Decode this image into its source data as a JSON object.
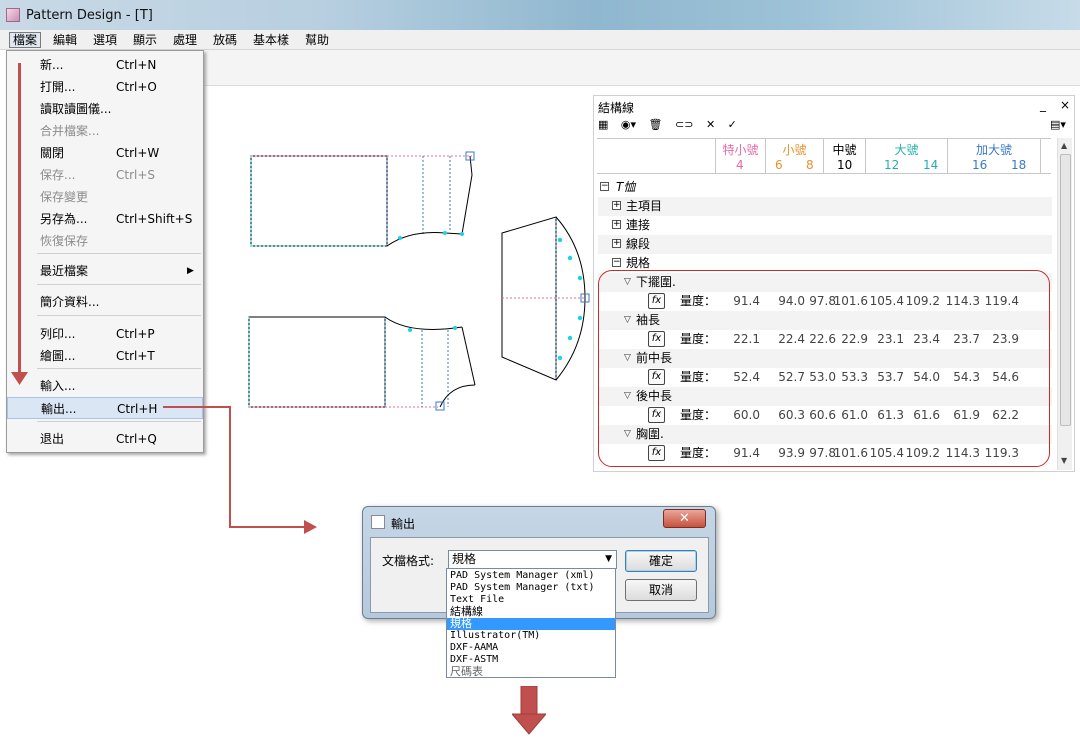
{
  "window": {
    "title": "Pattern Design - [T]"
  },
  "menubar": [
    "檔案",
    "編輯",
    "選項",
    "顯示",
    "處理",
    "放碼",
    "基本樣",
    "幫助"
  ],
  "file_menu": {
    "items": [
      {
        "label": "新...",
        "shortcut": "Ctrl+N",
        "disabled": false
      },
      {
        "label": "打開...",
        "shortcut": "Ctrl+O",
        "disabled": false
      },
      {
        "label": "讀取讀圖儀...",
        "shortcut": "",
        "disabled": false
      },
      {
        "label": "合并檔案...",
        "shortcut": "",
        "disabled": true
      },
      {
        "label": "關閉",
        "shortcut": "Ctrl+W",
        "disabled": false
      },
      {
        "label": "保存...",
        "shortcut": "Ctrl+S",
        "disabled": true
      },
      {
        "label": "保存變更",
        "shortcut": "",
        "disabled": true
      },
      {
        "label": "另存為...",
        "shortcut": "Ctrl+Shift+S",
        "disabled": false
      },
      {
        "label": "恢復保存",
        "shortcut": "",
        "disabled": true
      },
      {
        "label": "最近檔案",
        "shortcut": "",
        "disabled": false
      },
      {
        "label": "簡介資料...",
        "shortcut": "",
        "disabled": false
      },
      {
        "label": "列印...",
        "shortcut": "Ctrl+P",
        "disabled": false
      },
      {
        "label": "繪圖...",
        "shortcut": "Ctrl+T",
        "disabled": false
      },
      {
        "label": "輸入...",
        "shortcut": "",
        "disabled": false
      },
      {
        "label": "輸出...",
        "shortcut": "Ctrl+H",
        "disabled": false
      },
      {
        "label": "退出",
        "shortcut": "Ctrl+Q",
        "disabled": false
      }
    ]
  },
  "panel": {
    "title": "結構線",
    "controls": {
      "minimize": "_",
      "close": "×"
    },
    "size_groups": [
      {
        "name": "特小號",
        "sizes": [
          "4"
        ],
        "color": "#e86aa6"
      },
      {
        "name": "小號",
        "sizes": [
          "6",
          "8"
        ],
        "color": "#e8922e"
      },
      {
        "name": "中號",
        "sizes": [
          "10"
        ],
        "color": "#000000"
      },
      {
        "name": "大號",
        "sizes": [
          "12",
          "14"
        ],
        "color": "#23b2a8"
      },
      {
        "name": "加大號",
        "sizes": [
          "16",
          "18"
        ],
        "color": "#3a78c8"
      }
    ],
    "tree_root": "T恤",
    "tree_nodes": [
      "主項目",
      "連接",
      "線段",
      "規格"
    ],
    "measure_label": "量度：",
    "specs": [
      {
        "name": "下擺圍.",
        "values": [
          "91.4",
          "94.0",
          "97.8",
          "101.6",
          "105.4",
          "109.2",
          "114.3",
          "119.4"
        ]
      },
      {
        "name": "袖長",
        "values": [
          "22.1",
          "22.4",
          "22.6",
          "22.9",
          "23.1",
          "23.4",
          "23.7",
          "23.9"
        ]
      },
      {
        "name": "前中長",
        "values": [
          "52.4",
          "52.7",
          "53.0",
          "53.3",
          "53.7",
          "54.0",
          "54.3",
          "54.6"
        ]
      },
      {
        "name": "後中長",
        "values": [
          "60.0",
          "60.3",
          "60.6",
          "61.0",
          "61.3",
          "61.6",
          "61.9",
          "62.2"
        ]
      },
      {
        "name": "胸圍.",
        "values": [
          "91.4",
          "93.9",
          "97.8",
          "101.6",
          "105.4",
          "109.2",
          "114.3",
          "119.3"
        ]
      }
    ]
  },
  "dialog": {
    "title": "輸出",
    "field_label": "文檔格式:",
    "selected": "規格",
    "ok": "確定",
    "cancel": "取消",
    "options": [
      "PAD System Manager (xml)",
      "PAD System Manager (txt)",
      "Text File",
      "結構線",
      "規格",
      "Illustrator(TM)",
      "DXF-AAMA",
      "DXF-ASTM",
      "尺碼表"
    ]
  },
  "colors": {
    "accent_red": "#c0504d",
    "cyan_marker": "#19d3e6",
    "selection_blue": "#3399ff"
  }
}
